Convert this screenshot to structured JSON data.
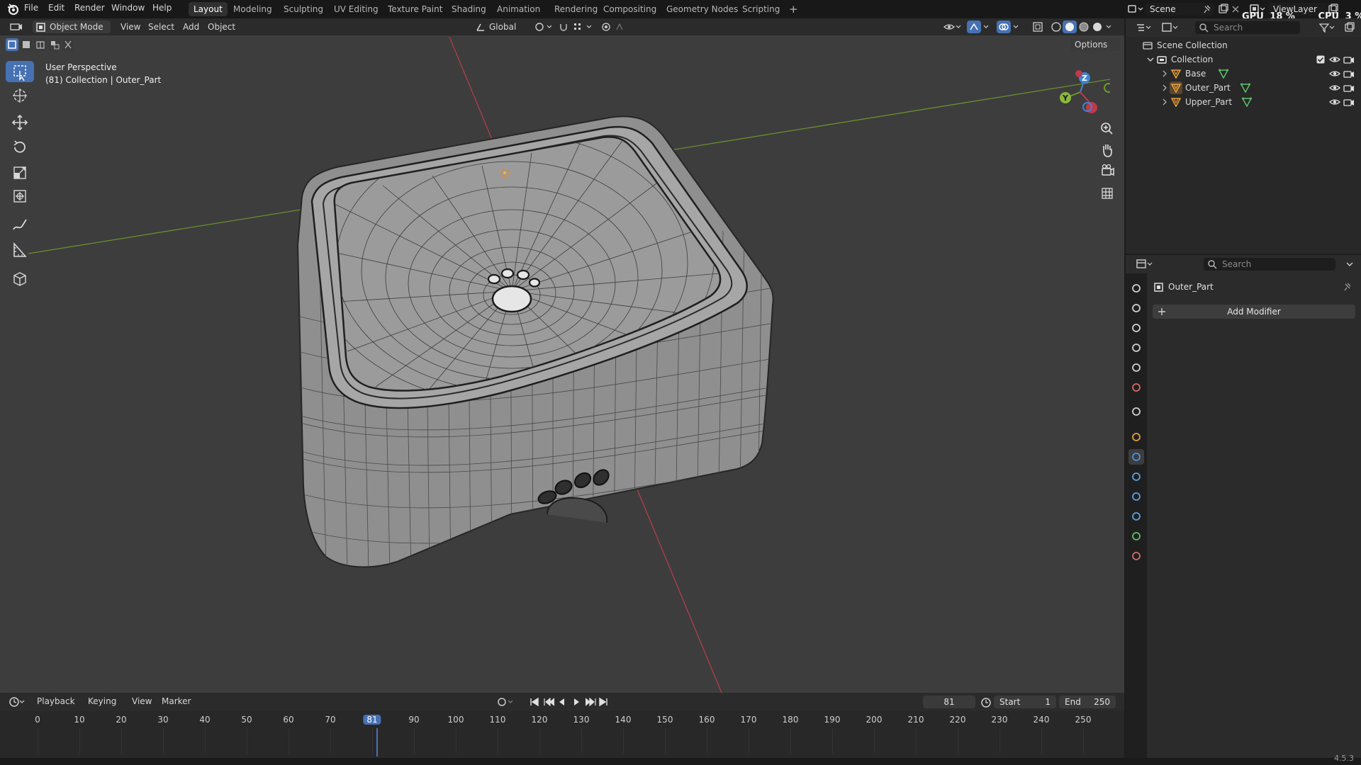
{
  "topbar": {
    "menus": [
      "File",
      "Edit",
      "Render",
      "Window",
      "Help"
    ],
    "workspaces": [
      "Layout",
      "Modeling",
      "Sculpting",
      "UV Editing",
      "Texture Paint",
      "Shading",
      "Animation",
      "Rendering",
      "Compositing",
      "Geometry Nodes",
      "Scripting"
    ],
    "active_workspace": "Layout",
    "add_tab": "+",
    "scene": "Scene",
    "view_layer": "ViewLayer",
    "gpu_label": "GPU",
    "gpu_value": "18 %",
    "cpu_label": "CPU",
    "cpu_value": "3 %"
  },
  "viewport": {
    "mode": "Object Mode",
    "menus": [
      "View",
      "Select",
      "Add",
      "Object"
    ],
    "orientation": "Global",
    "options": "Options",
    "overlay_line1": "User Perspective",
    "overlay_line2": "(81) Collection | Outer_Part",
    "gizmo_labels": [
      "Z",
      "Y"
    ]
  },
  "toolbar_icons": [
    "select-box-icon",
    "cursor-icon",
    "move-icon",
    "rotate-icon",
    "scale-icon",
    "transform-icon",
    "annotate-icon",
    "measure-icon",
    "add-cube-icon"
  ],
  "outliner": {
    "search_placeholder": "Search",
    "root": "Scene Collection",
    "collection": "Collection",
    "objects": [
      "Base",
      "Outer_Part",
      "Upper_Part"
    ]
  },
  "properties": {
    "search_placeholder": "Search",
    "object_name": "Outer_Part",
    "add_modifier": "Add Modifier",
    "tabs": [
      "tool-icon",
      "render-icon",
      "output-icon",
      "view-layer-icon",
      "scene-icon",
      "world-icon",
      "collection-icon",
      "object-icon",
      "modifier-icon",
      "particles-icon",
      "physics-icon",
      "constraints-icon",
      "data-icon",
      "material-icon"
    ],
    "active_tab": "modifier-icon"
  },
  "timeline": {
    "menus": [
      "Playback",
      "Keying",
      "View",
      "Marker"
    ],
    "current_frame": "81",
    "start_label": "Start",
    "start_value": "1",
    "end_label": "End",
    "end_value": "250",
    "ticks": [
      "0",
      "10",
      "20",
      "30",
      "40",
      "50",
      "60",
      "70",
      "81",
      "90",
      "100",
      "110",
      "120",
      "130",
      "140",
      "150",
      "160",
      "170",
      "180",
      "190",
      "200",
      "210",
      "220",
      "230",
      "240",
      "250"
    ],
    "frame_fraction": 0.324
  },
  "statusbar": {
    "version": "4.5.3"
  },
  "colors": {
    "accent": "#4672b4",
    "x_axis": "#c0394a",
    "y_axis": "#6f9a2c",
    "z_gizmo": "#3d84d4",
    "mesh_icon": "#e8a03a",
    "filter_icon": "#5fc06a"
  }
}
